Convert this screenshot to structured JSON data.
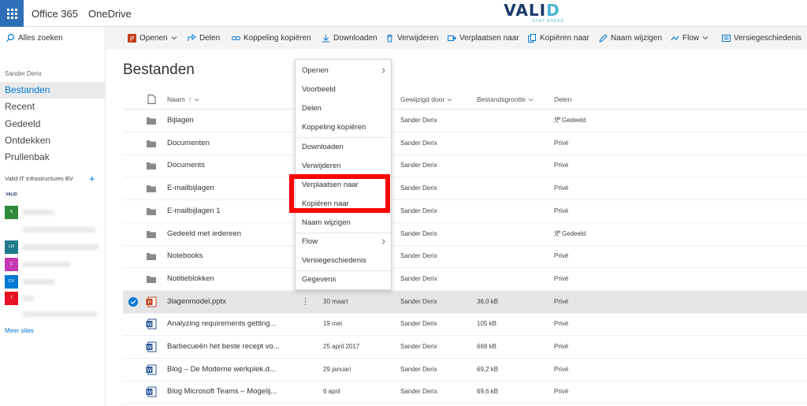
{
  "suite": {
    "app_launcher": "app-launcher",
    "office": "Office 365",
    "app": "OneDrive"
  },
  "brand": {
    "name_main": "VALI",
    "name_accent": "D",
    "tagline": "STAY AHEAD"
  },
  "search": {
    "label": "Alles zoeken"
  },
  "nav": {
    "user": "Sander Derix",
    "items": [
      "Bestanden",
      "Recent",
      "Gedeeld",
      "Ontdekken",
      "Prullenbak"
    ],
    "group": "Valid IT Infrastructures BV",
    "sites": [
      {
        "initials": "VALID",
        "color": "#ffffff"
      },
      {
        "initials": "S",
        "color": "#2e8b3a"
      },
      {
        "initials": "",
        "color": "#ffffff"
      },
      {
        "initials": "LR",
        "color": "#1f7a8c"
      },
      {
        "initials": "C",
        "color": "#c239b3"
      },
      {
        "initials": "CV",
        "color": "#0078d4"
      },
      {
        "initials": "T",
        "color": "#e81123"
      },
      {
        "initials": "",
        "color": "#ffffff"
      }
    ],
    "more_sites": "Meer sites"
  },
  "commands": [
    "Openen",
    "Delen",
    "Koppeling kopiëren",
    "Downloaden",
    "Verwijderen",
    "Verplaatsen naar",
    "Kopiëren naar",
    "Naam wijzigen",
    "Flow",
    "Versiegeschiedenis"
  ],
  "main": {
    "title": "Bestanden",
    "columns": {
      "name": "Naam",
      "sort_indicator": "↑",
      "modified_by": "Gewijzigd door",
      "size": "Bestandsgrootte",
      "sharing": "Delen"
    }
  },
  "files": [
    {
      "name": "Bijlagen",
      "type": "folder",
      "modified": "",
      "by": "Sander Derix",
      "size": "",
      "sharing": "Gedeeld",
      "shared": true,
      "selected": false
    },
    {
      "name": "Documenten",
      "type": "folder",
      "modified": "",
      "by": "Sander Derix",
      "size": "",
      "sharing": "Privé",
      "shared": false,
      "selected": false
    },
    {
      "name": "Documents",
      "type": "folder",
      "modified": "",
      "by": "Sander Derix",
      "size": "",
      "sharing": "Privé",
      "shared": false,
      "selected": false
    },
    {
      "name": "E-mailbijlagen",
      "type": "folder",
      "modified": "",
      "by": "Sander Derix",
      "size": "",
      "sharing": "Privé",
      "shared": false,
      "selected": false
    },
    {
      "name": "E-mailbijlagen 1",
      "type": "folder",
      "modified": "",
      "by": "Sander Derix",
      "size": "",
      "sharing": "Privé",
      "shared": false,
      "selected": false
    },
    {
      "name": "Gedeeld met iedereen",
      "type": "folder",
      "modified": "",
      "by": "Sander Derix",
      "size": "",
      "sharing": "Gedeeld",
      "shared": true,
      "selected": false
    },
    {
      "name": "Notebooks",
      "type": "folder",
      "modified": "",
      "by": "Sander Derix",
      "size": "",
      "sharing": "Privé",
      "shared": false,
      "selected": false
    },
    {
      "name": "Notitieblokken",
      "type": "folder",
      "modified": "",
      "by": "Sander Derix",
      "size": "",
      "sharing": "Privé",
      "shared": false,
      "selected": false
    },
    {
      "name": "3lagenmodel.pptx",
      "type": "pptx",
      "modified": "30 maart",
      "by": "Sander Derix",
      "size": "36,0 kB",
      "sharing": "Privé",
      "shared": false,
      "selected": true
    },
    {
      "name": "Analyzing requirements getting...",
      "type": "docx",
      "modified": "19 mei",
      "by": "Sander Derix",
      "size": "105 kB",
      "sharing": "Privé",
      "shared": false,
      "selected": false
    },
    {
      "name": "Barbecueën het beste recept vo...",
      "type": "docx",
      "modified": "25 april 2017",
      "by": "Sander Derix",
      "size": "668 kB",
      "sharing": "Privé",
      "shared": false,
      "selected": false
    },
    {
      "name": "Blog – De Moderne werkplek.d...",
      "type": "docx",
      "modified": "29 januari",
      "by": "Sander Derix",
      "size": "69,2 kB",
      "sharing": "Privé",
      "shared": false,
      "selected": false
    },
    {
      "name": "Blog Microsoft Teams – Mogelij...",
      "type": "docx",
      "modified": "6 april",
      "by": "Sander Derix",
      "size": "69,6 kB",
      "sharing": "Privé",
      "shared": false,
      "selected": false
    }
  ],
  "row_more": "⋮",
  "context_menu": [
    "Openen",
    "Voorbeeld",
    "Delen",
    "Koppeling kopiëren",
    "Downloaden",
    "Verwijderen",
    "Verplaatsen naar",
    "Kopiëren naar",
    "Naam wijzigen",
    "Flow",
    "Versiegeschiedenis",
    "Gegevens"
  ],
  "colors": {
    "accent": "#0078d4",
    "suite": "#2f6fb7",
    "highlight": "#ff0000",
    "folder": "#8a8a8a",
    "pptx": "#c43e1c",
    "docx": "#2b579a"
  }
}
